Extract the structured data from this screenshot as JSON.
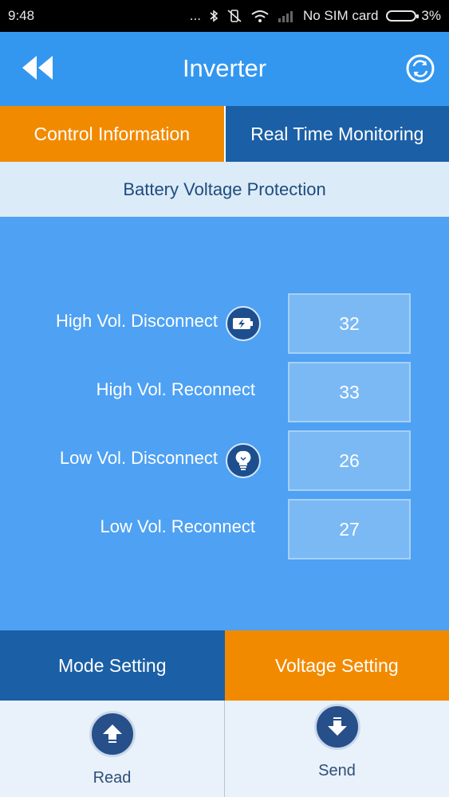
{
  "status_bar": {
    "time": "9:48",
    "dots": "...",
    "carrier": "No SIM card",
    "battery": "3%"
  },
  "header": {
    "title": "Inverter",
    "back_icon": "double-chevron-left-icon",
    "refresh_icon": "refresh-icon"
  },
  "tabs": [
    {
      "label": "Control Information",
      "active": true
    },
    {
      "label": "Real Time Monitoring",
      "active": false
    }
  ],
  "section": {
    "title": "Battery Voltage Protection"
  },
  "rows": [
    {
      "label": "High Vol. Disconnect",
      "value": "32",
      "icon": "battery-charging-icon"
    },
    {
      "label": "High Vol. Reconnect",
      "value": "33"
    },
    {
      "label": "Low Vol. Disconnect",
      "value": "26",
      "icon": "lightbulb-icon"
    },
    {
      "label": "Low Vol. Reconnect",
      "value": "27"
    }
  ],
  "bottom_tabs": [
    {
      "label": "Mode Setting",
      "active": false
    },
    {
      "label": "Voltage Setting",
      "active": true
    }
  ],
  "actions": {
    "read": {
      "label": "Read",
      "icon": "arrow-up-icon"
    },
    "send": {
      "label": "Send",
      "icon": "arrow-down-icon"
    }
  },
  "colors": {
    "accent_orange": "#f28a00",
    "header_blue": "#3397f0",
    "panel_blue": "#4ea1f3",
    "dark_blue": "#1b5fa6"
  }
}
